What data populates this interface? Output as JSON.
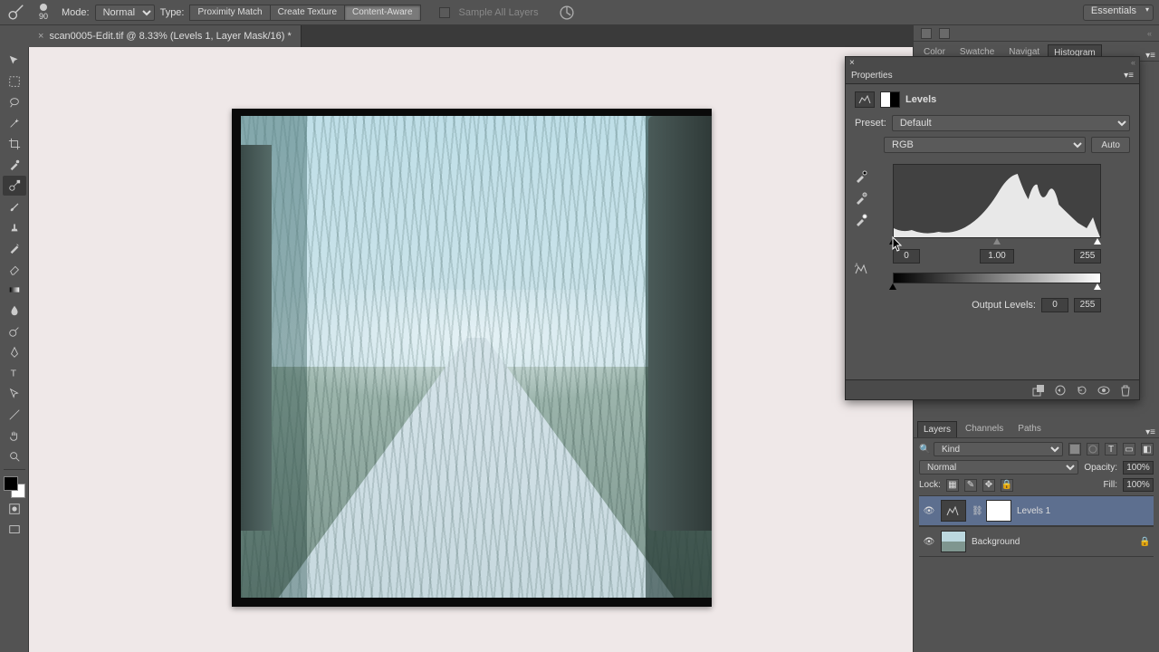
{
  "optionsBar": {
    "brushSize": "90",
    "modeLabel": "Mode:",
    "modeValue": "Normal",
    "typeLabel": "Type:",
    "typeButtons": [
      "Proximity Match",
      "Create Texture",
      "Content-Aware"
    ],
    "typeActiveIndex": 2,
    "sampleAll": "Sample All Layers",
    "workspace": "Essentials"
  },
  "document": {
    "title": "scan0005-Edit.tif @ 8.33% (Levels 1, Layer Mask/16) *"
  },
  "rightTabs1": [
    "Color",
    "Swatche",
    "Navigat",
    "Histogram"
  ],
  "rightTabs1Active": 3,
  "properties": {
    "title": "Properties",
    "adjName": "Levels",
    "presetLabel": "Preset:",
    "presetValue": "Default",
    "channelValue": "RGB",
    "autoLabel": "Auto",
    "inputLevels": {
      "black": "0",
      "mid": "1.00",
      "white": "255"
    },
    "outputLabel": "Output Levels:",
    "outputLevels": {
      "black": "0",
      "white": "255"
    }
  },
  "layersTabs": [
    "Layers",
    "Channels",
    "Paths"
  ],
  "layersTabsActive": 0,
  "layersPanel": {
    "kindLabel": "Kind",
    "blendMode": "Normal",
    "opacityLabel": "Opacity:",
    "opacityValue": "100%",
    "lockLabel": "Lock:",
    "fillLabel": "Fill:",
    "fillValue": "100%",
    "layers": [
      {
        "name": "Levels 1",
        "selected": true,
        "adjustment": true,
        "locked": false
      },
      {
        "name": "Background",
        "selected": false,
        "adjustment": false,
        "locked": true
      }
    ]
  }
}
